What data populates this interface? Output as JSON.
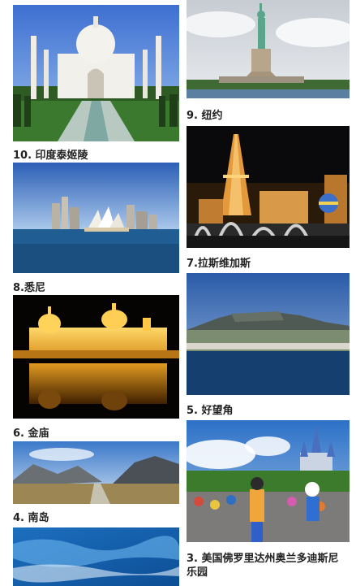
{
  "items": {
    "tajmahal": {
      "caption": "10. 印度泰姬陵"
    },
    "newyork": {
      "caption": "9. 纽约"
    },
    "sydney": {
      "caption": "8.悉尼"
    },
    "lasvegas": {
      "caption": "7.拉斯维加斯"
    },
    "goldentemple": {
      "caption": "6. 金庙"
    },
    "capetown": {
      "caption": "5. 好望角"
    },
    "southisland": {
      "caption": "4. 南岛"
    },
    "disney": {
      "caption": "3. 美国佛罗里达州奥兰多迪斯尼乐园"
    },
    "ocean": {
      "caption": ""
    }
  }
}
